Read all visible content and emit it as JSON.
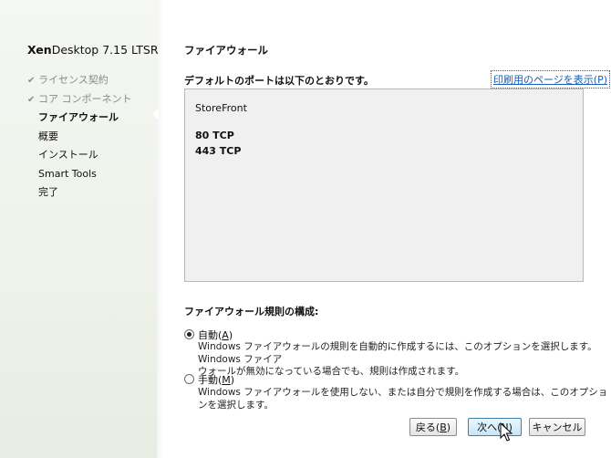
{
  "sidebar": {
    "product_bold": "Xen",
    "product_rest": "Desktop 7.15 LTSR",
    "steps": [
      {
        "label": "ライセンス契約",
        "state": "done"
      },
      {
        "label": "コア コンポーネント",
        "state": "done"
      },
      {
        "label": "ファイアウォール",
        "state": "current"
      },
      {
        "label": "概要",
        "state": "todo"
      },
      {
        "label": "インストール",
        "state": "todo"
      },
      {
        "label": "Smart Tools",
        "state": "todo"
      },
      {
        "label": "完了",
        "state": "todo"
      }
    ]
  },
  "main": {
    "title": "ファイアウォール",
    "subtitle": "デフォルトのポートは以下のとおりです。",
    "print_link": "印刷用のページを表示(P)",
    "ports": {
      "component": "StoreFront",
      "lines": [
        "80 TCP",
        "443 TCP"
      ]
    },
    "config_heading": "ファイアウォール規則の構成:",
    "options": [
      {
        "label_prefix": "自動(",
        "label_key": "A",
        "label_suffix": ")",
        "checked": true,
        "description_line1": "Windows ファイアウォールの規則を自動的に作成するには、このオプションを選択します。Windows ファイア",
        "description_line2": "ウォールが無効になっている場合でも、規則は作成されます。"
      },
      {
        "label_prefix": "手動(",
        "label_key": "M",
        "label_suffix": ")",
        "checked": false,
        "description_line1": "Windows ファイアウォールを使用しない、または自分で規則を作成する場合は、このオプションを選択します。"
      }
    ]
  },
  "buttons": {
    "back_prefix": "戻る(",
    "back_key": "B",
    "back_suffix": ")",
    "next_prefix": "次へ(",
    "next_key": "N",
    "next_suffix": ")",
    "cancel": "キャンセル"
  }
}
